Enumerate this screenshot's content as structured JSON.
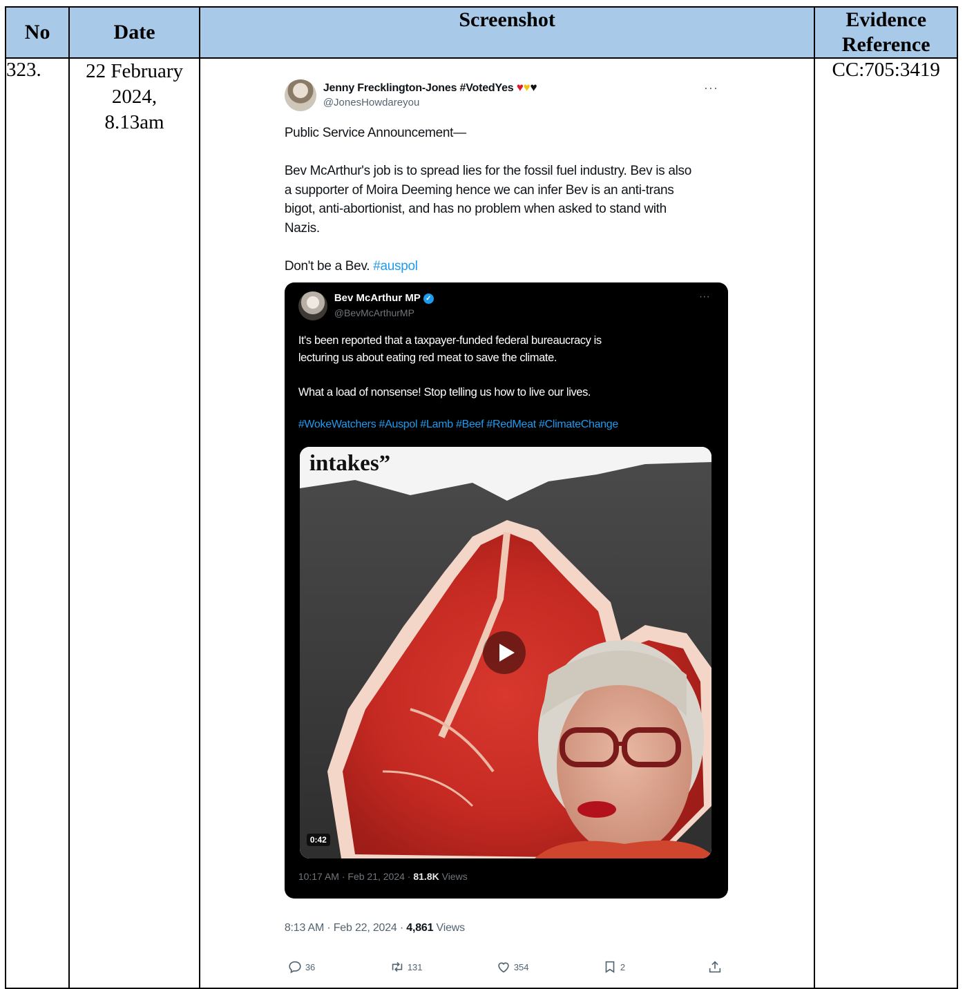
{
  "table": {
    "headers": {
      "no": "No",
      "date": "Date",
      "screenshot": "Screenshot",
      "evidence_line1": "Evidence",
      "evidence_line2": "Reference"
    },
    "row": {
      "no": "323.",
      "date_line1": "22 February",
      "date_line2": "2024,",
      "date_line3": "8.13am",
      "reference": "CC:705:3419"
    }
  },
  "tweet": {
    "author_name": "Jenny Frecklington-Jones #VotedYes",
    "author_handle": "@JonesHowdareyou",
    "more": "···",
    "body": "Public Service Announcement—\n\nBev McArthur's job is to spread lies for the fossil fuel industry. Bev is also\na supporter of Moira Deeming hence we can infer Bev is an anti-trans\nbigot, anti-abortionist, and has no problem when asked to stand with\nNazis.\n\n",
    "body_end": "Don't be a Bev. ",
    "hashtag": "#auspol",
    "quoted": {
      "author_name": "Bev McArthur MP",
      "author_handle": "@BevMcArthurMP",
      "more": "···",
      "text": "It's been reported that a taxpayer-funded federal bureaucracy is\nlecturing us about eating red meat to save the climate.\n\nWhat a load of nonsense! Stop telling us how to live our lives.",
      "hashtags": "#WokeWatchers #Auspol  #Lamb #Beef #RedMeat #ClimateChange",
      "video_caption": "intakes”",
      "video_duration": "0:42",
      "meta_time": "10:17 AM · Feb 21, 2024 · ",
      "meta_views_count": "81.8K",
      "meta_views_label": " Views"
    },
    "meta_time": "8:13 AM · Feb 22, 2024 · ",
    "views_count": "4,861",
    "views_label": " Views",
    "actions": {
      "replies": "36",
      "reposts": "131",
      "likes": "354",
      "bookmarks": "2"
    }
  },
  "icons": [
    "heart-red-icon",
    "heart-yellow-icon",
    "heart-black-icon",
    "verified-badge-icon",
    "play-icon",
    "reply-icon",
    "repost-icon",
    "like-icon",
    "bookmark-icon",
    "share-icon"
  ],
  "colors": {
    "header_bg": "#a9c9e8",
    "link": "#1d9bf0",
    "muted": "#536471"
  }
}
